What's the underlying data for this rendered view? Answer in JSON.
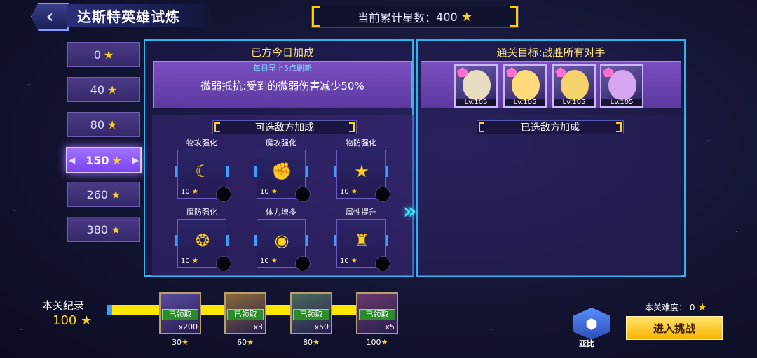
{
  "header": {
    "back_icon": "chevron-left-icon",
    "title": "达斯特英雄试炼",
    "star_total_label": "当前累计星数：",
    "star_total": "400",
    "star_glyph": "★"
  },
  "tiers": [
    {
      "value": "0"
    },
    {
      "value": "40"
    },
    {
      "value": "80"
    },
    {
      "value": "150",
      "active": true
    },
    {
      "value": "260"
    },
    {
      "value": "380"
    }
  ],
  "own_buff": {
    "heading": "已方今日加成",
    "refresh_note": "每日早上5点刷新",
    "text": "微弱抵抗:受到的微弱伤害减少50%"
  },
  "goal": {
    "heading": "通关目标:战胜所有对手",
    "enemies": [
      {
        "level": "Lv.105",
        "color": "#e8dcc0"
      },
      {
        "level": "Lv.105",
        "color": "#ffd97a"
      },
      {
        "level": "Lv.105",
        "color": "#f5d36a"
      },
      {
        "level": "Lv.105",
        "color": "#d7a6f0"
      }
    ]
  },
  "enemy_buffs": {
    "available_heading": "可选敌方加成",
    "selected_heading": "已选敌方加成",
    "items": [
      {
        "label": "物攻强化",
        "cost": "10",
        "icon": "moon-star-icon",
        "glyph": "☾"
      },
      {
        "label": "魔攻强化",
        "cost": "10",
        "icon": "flexed-arm-icon",
        "glyph": "✊"
      },
      {
        "label": "物防强化",
        "cost": "10",
        "icon": "star-shield-icon",
        "glyph": "★"
      },
      {
        "label": "魔防强化",
        "cost": "10",
        "icon": "laurel-shield-icon",
        "glyph": "❂"
      },
      {
        "label": "体力增多",
        "cost": "10",
        "icon": "eye-swirl-icon",
        "glyph": "◉"
      },
      {
        "label": "属性提升",
        "cost": "10",
        "icon": "armor-icon",
        "glyph": "♜"
      }
    ],
    "transfer_icon": "double-chevron-right-icon",
    "transfer_glyph": "»"
  },
  "record": {
    "label": "本关纪录",
    "value": "100"
  },
  "rewards": [
    {
      "status": "已领取",
      "qty": "x200",
      "stars": "30"
    },
    {
      "status": "已领取",
      "qty": "x3",
      "stars": "60"
    },
    {
      "status": "已领取",
      "qty": "x50",
      "stars": "80"
    },
    {
      "status": "已领取",
      "qty": "x5",
      "stars": "100"
    }
  ],
  "difficulty": {
    "label": "本关难度：",
    "value": "0"
  },
  "yabi_label": "亚比",
  "challenge_button": "进入挑战",
  "colors": {
    "accent_cyan": "#39c6ff",
    "star_gold": "#ffd21a",
    "button_gold": "#f7b300",
    "tier_active": "#7a44ee"
  }
}
